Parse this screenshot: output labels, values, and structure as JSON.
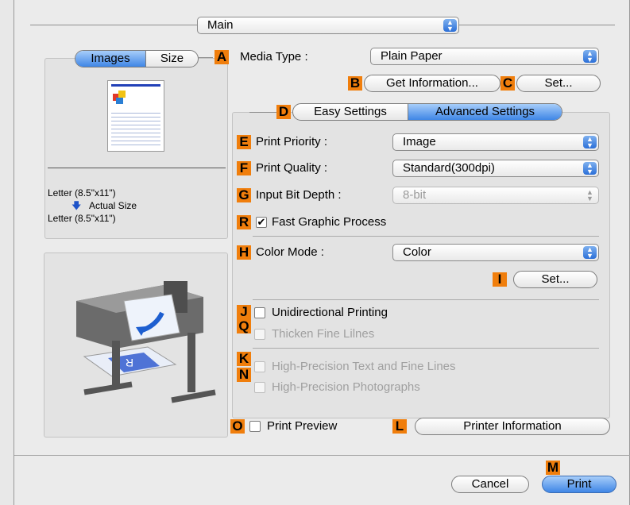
{
  "main_popup": {
    "value": "Main"
  },
  "preview_tabs": {
    "images": "Images",
    "size": "Size"
  },
  "paper_info": {
    "source": "Letter (8.5\"x11\")",
    "scaling": "Actual Size",
    "output": "Letter (8.5\"x11\")"
  },
  "media_type": {
    "label": "Media Type :",
    "value": "Plain Paper"
  },
  "buttons": {
    "get_information": "Get Information...",
    "set_media": "Set...",
    "set_color": "Set...",
    "printer_information": "Printer Information",
    "cancel": "Cancel",
    "print": "Print"
  },
  "settings_tabs": {
    "easy": "Easy Settings",
    "advanced": "Advanced Settings"
  },
  "print_priority": {
    "label": "Print Priority :",
    "value": "Image"
  },
  "print_quality": {
    "label": "Print Quality :",
    "value": "Standard(300dpi)"
  },
  "input_bit_depth": {
    "label": "Input Bit Depth :",
    "value": "8-bit"
  },
  "fast_graphic": {
    "label": "Fast Graphic Process",
    "checked": true
  },
  "color_mode": {
    "label": "Color Mode :",
    "value": "Color"
  },
  "unidirectional": {
    "label": "Unidirectional Printing"
  },
  "thicken": {
    "label": "Thicken Fine Lilnes"
  },
  "high_precision_text": {
    "label": "High-Precision Text and Fine Lines"
  },
  "high_precision_photo": {
    "label": "High-Precision Photographs"
  },
  "print_preview": {
    "label": "Print Preview"
  },
  "callouts": {
    "A": "A",
    "B": "B",
    "C": "C",
    "D": "D",
    "E": "E",
    "F": "F",
    "G": "G",
    "R": "R",
    "H": "H",
    "I": "I",
    "J": "J",
    "Q": "Q",
    "K": "K",
    "N": "N",
    "O": "O",
    "L": "L",
    "M": "M"
  },
  "colors": {
    "callout": "#f07e0c",
    "accent": "#3f86e6"
  }
}
